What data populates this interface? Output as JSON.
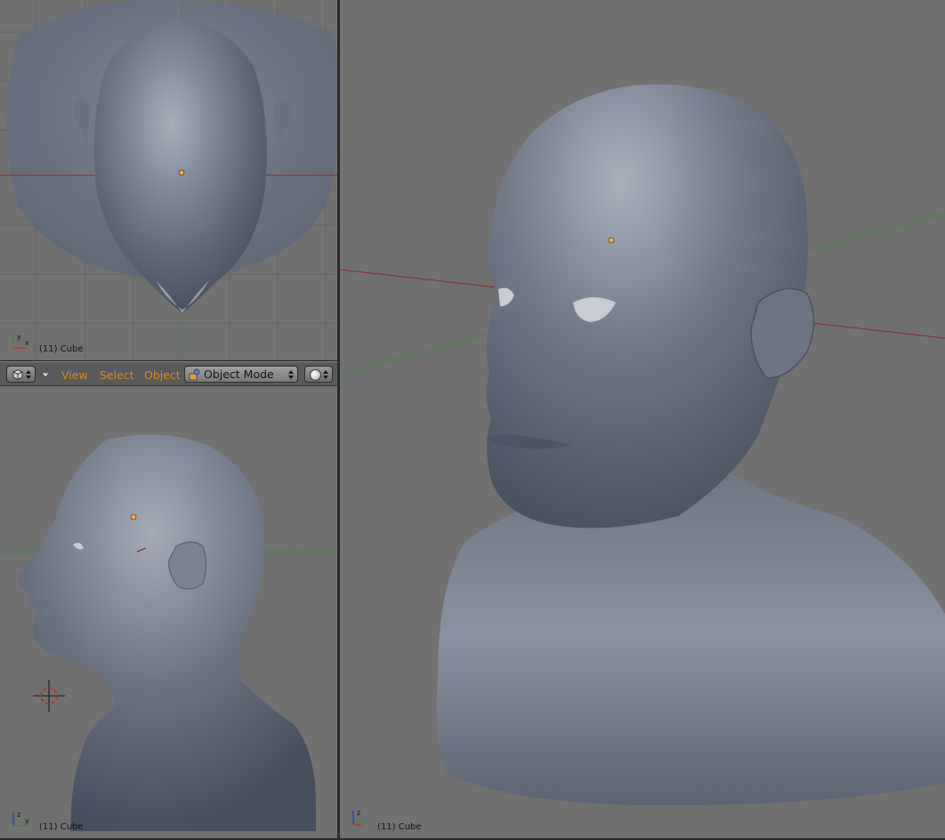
{
  "viewports": {
    "top": {
      "label": "(11) Cube"
    },
    "side": {
      "label": "(11) Cube"
    },
    "perspective": {
      "label": "(11) Cube"
    }
  },
  "header": {
    "menus": {
      "view": "View",
      "select": "Select",
      "object": "Object"
    },
    "mode": "Object Mode",
    "editor_type_icon": "cube-icon",
    "shading_icon": "solid-sphere-icon"
  },
  "colors": {
    "viewport_bg": "#717171",
    "mesh": "#6e7585",
    "menu_text": "#e08a1e",
    "x_axis": "#8a2a2a",
    "y_axis": "#3e8a3e",
    "origin_dot": "#f0b030"
  }
}
